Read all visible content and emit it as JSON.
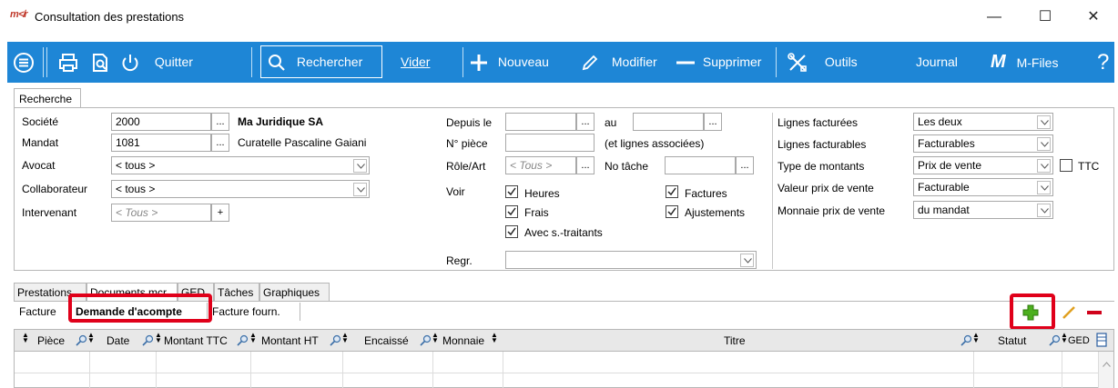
{
  "window": {
    "logo": "m≮r",
    "title": "Consultation des prestations",
    "minimize": "—",
    "maximize": "☐",
    "close": "✕"
  },
  "toolbar": {
    "quit": "Quitter",
    "search": "Rechercher",
    "clear": "Vider",
    "new": "Nouveau",
    "edit": "Modifier",
    "delete": "Supprimer",
    "tools": "Outils",
    "journal": "Journal",
    "mfiles_logo": "M",
    "mfiles": "M-Files",
    "help": "?",
    "accent": "#1e86d6"
  },
  "search": {
    "tab_label": "Recherche",
    "left": {
      "societe_label": "Société",
      "societe_value": "2000",
      "societe_name": "Ma Juridique SA",
      "mandat_label": "Mandat",
      "mandat_value": "1081",
      "mandat_name": "Curatelle Pascaline Gaiani",
      "avocat_label": "Avocat",
      "avocat_value": "< tous >",
      "collab_label": "Collaborateur",
      "collab_value": "< tous >",
      "intervenant_label": "Intervenant",
      "intervenant_placeholder": "< Tous >",
      "plus": "+",
      "dots": "..."
    },
    "middle": {
      "depuis_label": "Depuis le",
      "au_label": "au",
      "piece_label": "N° pièce",
      "piece_note": "(et lignes associées)",
      "role_label": "Rôle/Art",
      "role_placeholder": "< Tous >",
      "tache_label": "No tâche",
      "voir_label": "Voir",
      "cb_heures": "Heures",
      "cb_factures": "Factures",
      "cb_frais": "Frais",
      "cb_ajustements": "Ajustements",
      "cb_soustraitants": "Avec s.-traitants",
      "regr_label": "Regr."
    },
    "right": {
      "lignes_facturees_label": "Lignes facturées",
      "lignes_facturees_value": "Les deux",
      "lignes_facturables_label": "Lignes facturables",
      "lignes_facturables_value": "Facturables",
      "type_montants_label": "Type de montants",
      "type_montants_value": "Prix de vente",
      "ttc_label": "TTC",
      "valeur_prix_label": "Valeur prix de vente",
      "valeur_prix_value": "Facturable",
      "monnaie_prix_label": "Monnaie prix de vente",
      "monnaie_prix_value": "du mandat"
    }
  },
  "tabs": [
    "Prestations",
    "Documents mcr",
    "GED",
    "Tâches",
    "Graphiques"
  ],
  "subtabs": [
    "Facture",
    "Demande d'acompte",
    "Facture fourn."
  ],
  "grid": {
    "columns": [
      "Pièce",
      "Date",
      "Montant TTC",
      "Montant HT",
      "Encaissé",
      "Monnaie",
      "Titre",
      "Statut",
      "GED"
    ]
  },
  "colors": {
    "highlight": "#e0001a",
    "add": "#4caf1e",
    "remove": "#d0021b"
  }
}
